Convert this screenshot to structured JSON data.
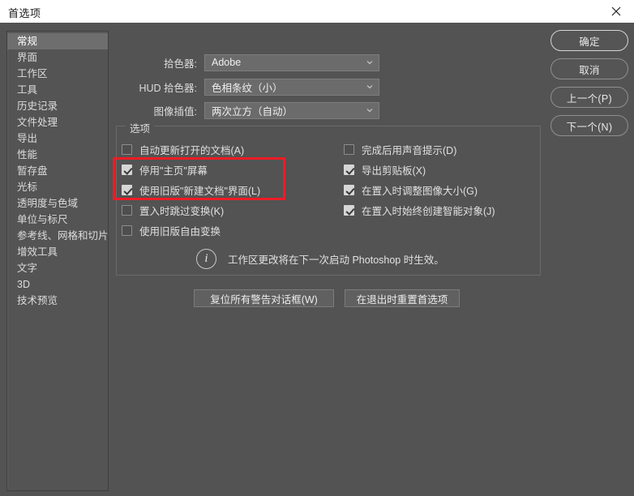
{
  "window": {
    "title": "首选项",
    "close_icon": "close-icon"
  },
  "sidebar": {
    "items": [
      {
        "label": "常规",
        "selected": true
      },
      {
        "label": "界面",
        "selected": false
      },
      {
        "label": "工作区",
        "selected": false
      },
      {
        "label": "工具",
        "selected": false
      },
      {
        "label": "历史记录",
        "selected": false
      },
      {
        "label": "文件处理",
        "selected": false
      },
      {
        "label": "导出",
        "selected": false
      },
      {
        "label": "性能",
        "selected": false
      },
      {
        "label": "暂存盘",
        "selected": false
      },
      {
        "label": "光标",
        "selected": false
      },
      {
        "label": "透明度与色域",
        "selected": false
      },
      {
        "label": "单位与标尺",
        "selected": false
      },
      {
        "label": "参考线、网格和切片",
        "selected": false
      },
      {
        "label": "增效工具",
        "selected": false
      },
      {
        "label": "文字",
        "selected": false
      },
      {
        "label": "3D",
        "selected": false
      },
      {
        "label": "技术预览",
        "selected": false
      }
    ]
  },
  "action_buttons": [
    {
      "label": "确定",
      "primary": true
    },
    {
      "label": "取消",
      "primary": false
    },
    {
      "label": "上一个(P)",
      "primary": false
    },
    {
      "label": "下一个(N)",
      "primary": false
    }
  ],
  "selectors": [
    {
      "label": "拾色器:",
      "value": "Adobe"
    },
    {
      "label": "HUD 拾色器:",
      "value": "色相条纹（小）"
    },
    {
      "label": "图像插值:",
      "value": "两次立方（自动）"
    }
  ],
  "options": {
    "legend": "选项",
    "left_column": [
      {
        "label": "自动更新打开的文档(A)",
        "checked": false
      },
      {
        "label": "停用\"主页\"屏幕",
        "checked": true
      },
      {
        "label": "使用旧版\"新建文档\"界面(L)",
        "checked": true
      },
      {
        "label": "置入时跳过变换(K)",
        "checked": false
      },
      {
        "label": "使用旧版自由变换",
        "checked": false
      }
    ],
    "right_column": [
      {
        "label": "完成后用声音提示(D)",
        "checked": false
      },
      {
        "label": "导出剪贴板(X)",
        "checked": true
      },
      {
        "label": "在置入时调整图像大小(G)",
        "checked": true
      },
      {
        "label": "在置入时始终创建智能对象(J)",
        "checked": true
      }
    ],
    "note": "工作区更改将在下一次启动 Photoshop 时生效。",
    "note_icon": "info-icon"
  },
  "bottom_buttons": {
    "reset_warnings": "复位所有警告对话框(W)",
    "reset_on_quit": "在退出时重置首选项"
  },
  "colors": {
    "dialog_bg": "#535353",
    "titlebar_bg": "#ffffff",
    "highlight_red": "#ee1c25",
    "selected_item_bg": "#6e6e6e"
  }
}
